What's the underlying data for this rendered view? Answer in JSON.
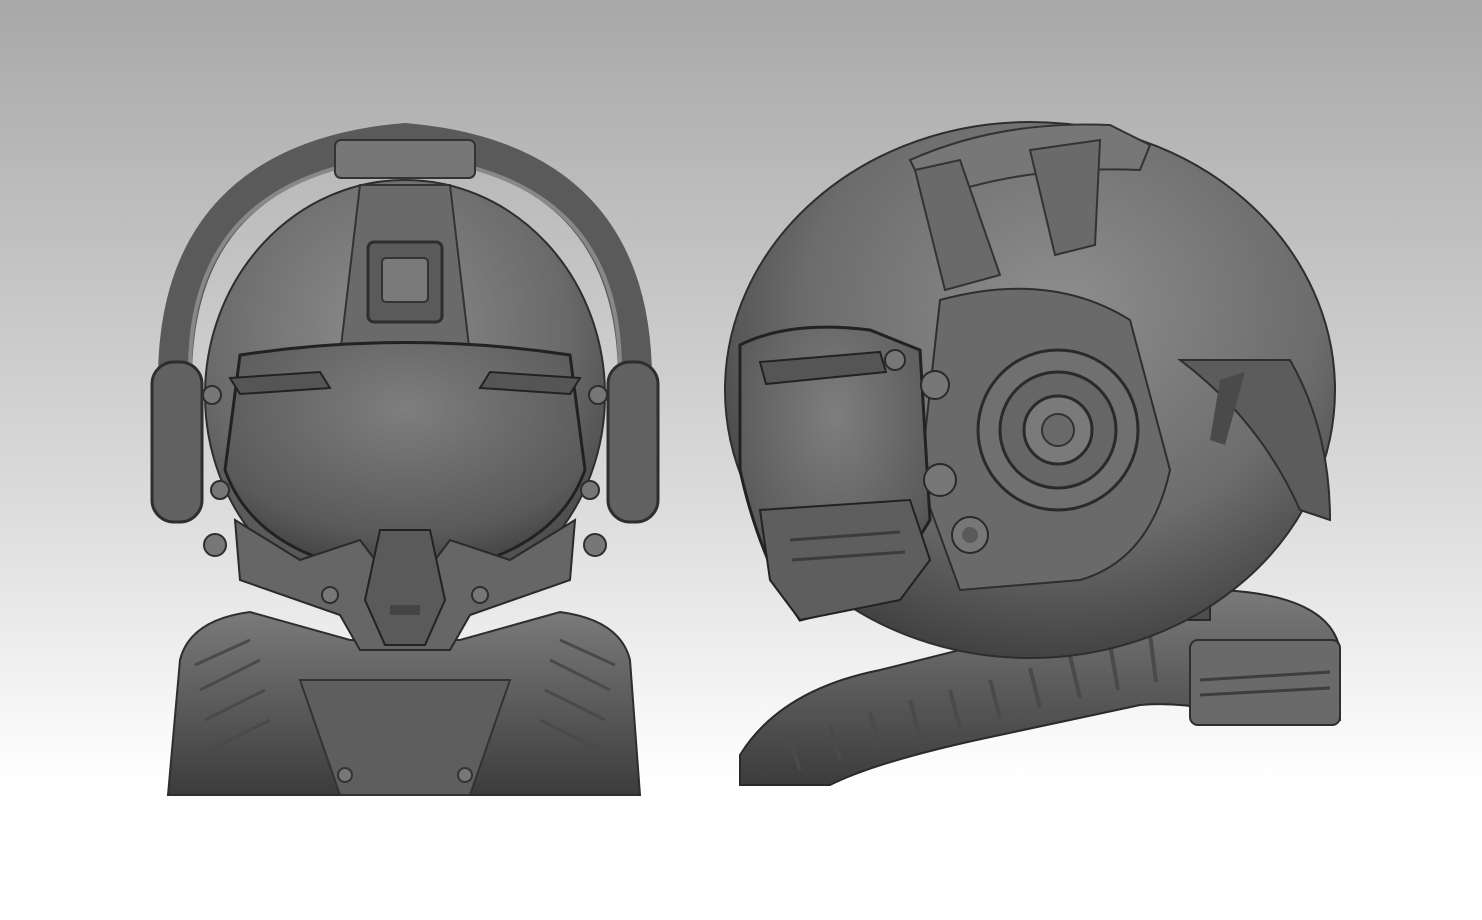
{
  "scene": {
    "subjects": [
      "helmet-front-view",
      "helmet-side-view"
    ],
    "colors": {
      "background_top": "#a9a9a9",
      "background_bottom": "#ffffff",
      "clay_base": "#6e6e6e",
      "clay_light": "#8a8a8a",
      "clay_dark": "#3e3e3e",
      "clay_shadow": "#2a2a2a"
    }
  }
}
